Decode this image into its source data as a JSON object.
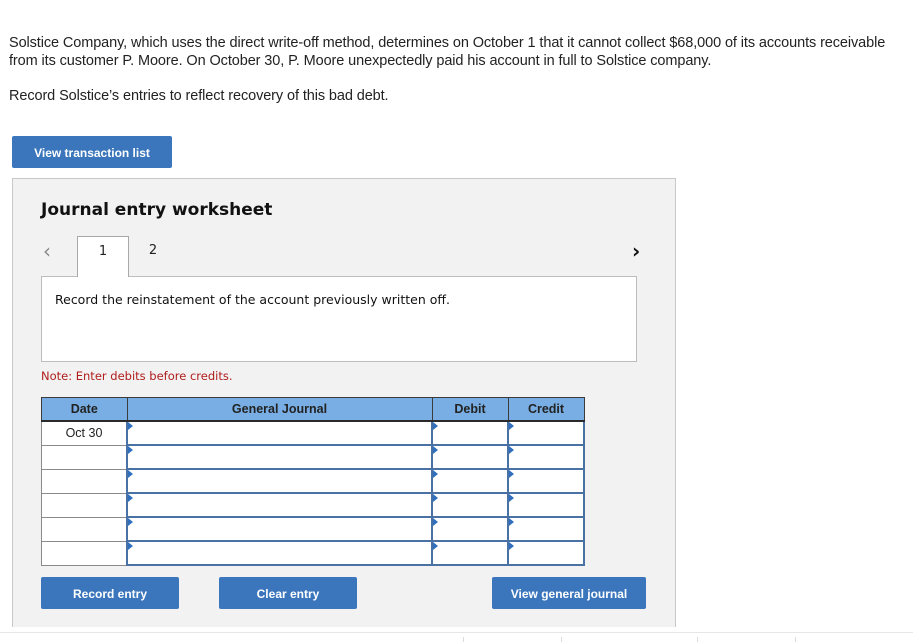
{
  "problem": {
    "text": "Solstice Company, which uses the direct write-off method, determines on October 1 that it cannot collect $68,000 of its accounts receivable from its customer P. Moore. On October 30, P. Moore unexpectedly paid his account in full to Solstice company.",
    "instruction": "Record Solstice’s entries to reflect recovery of this bad debt."
  },
  "buttons": {
    "view_transaction_list": "View transaction list",
    "record_entry": "Record entry",
    "clear_entry": "Clear entry",
    "view_general_journal": "View general journal"
  },
  "worksheet": {
    "title": "Journal entry worksheet",
    "nav": {
      "prev_icon": "‹",
      "next_icon": "›"
    },
    "tabs": [
      {
        "label": "1",
        "active": true
      },
      {
        "label": "2",
        "active": false
      }
    ],
    "instruction": "Record the reinstatement of the account previously written off.",
    "note": "Note: Enter debits before credits.",
    "table": {
      "headers": {
        "date": "Date",
        "general_journal": "General Journal",
        "debit": "Debit",
        "credit": "Credit"
      },
      "rows": [
        {
          "date": "Oct 30",
          "account": "",
          "debit": "",
          "credit": ""
        },
        {
          "date": "",
          "account": "",
          "debit": "",
          "credit": ""
        },
        {
          "date": "",
          "account": "",
          "debit": "",
          "credit": ""
        },
        {
          "date": "",
          "account": "",
          "debit": "",
          "credit": ""
        },
        {
          "date": "",
          "account": "",
          "debit": "",
          "credit": ""
        },
        {
          "date": "",
          "account": "",
          "debit": "",
          "credit": ""
        }
      ]
    }
  },
  "colors": {
    "button_blue": "#3b76bc",
    "header_blue": "#78aee3",
    "note_red": "#b01c1c",
    "cell_border": "#4a71a3"
  }
}
